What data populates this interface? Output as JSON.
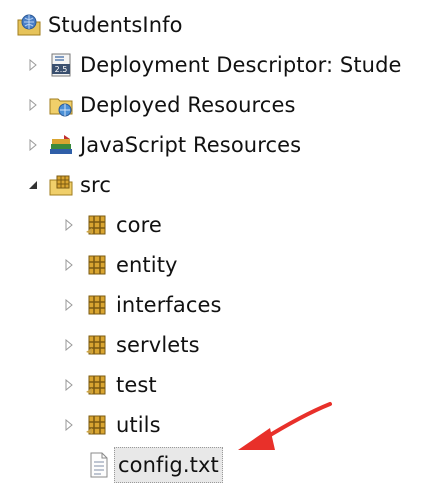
{
  "tree": {
    "project": {
      "label": "StudentsInfo",
      "icon": "web-project-icon"
    },
    "nodes": [
      {
        "id": "deployment-descriptor",
        "label": "Deployment Descriptor: Stude",
        "icon": "deployment-descriptor-icon",
        "expanded": false
      },
      {
        "id": "deployed-resources",
        "label": "Deployed Resources",
        "icon": "deployed-resources-icon",
        "expanded": false
      },
      {
        "id": "javascript-resources",
        "label": "JavaScript Resources",
        "icon": "javascript-resources-icon",
        "expanded": false
      },
      {
        "id": "src",
        "label": "src",
        "icon": "source-folder-icon",
        "expanded": true
      },
      {
        "id": "core",
        "label": "core",
        "icon": "package-icon",
        "expanded": false
      },
      {
        "id": "entity",
        "label": "entity",
        "icon": "package-icon",
        "expanded": false
      },
      {
        "id": "interfaces",
        "label": "interfaces",
        "icon": "package-icon",
        "expanded": false
      },
      {
        "id": "servlets",
        "label": "servlets",
        "icon": "package-icon",
        "expanded": false
      },
      {
        "id": "test",
        "label": "test",
        "icon": "package-icon",
        "expanded": false
      },
      {
        "id": "utils",
        "label": "utils",
        "icon": "package-icon",
        "expanded": false
      },
      {
        "id": "config-txt",
        "label": "config.txt",
        "icon": "text-file-icon",
        "selected": true
      }
    ]
  },
  "annotation": {
    "icon": "red-arrow-icon",
    "color": "#e8302a"
  },
  "colors": {
    "package": "#c8a040",
    "package-dark": "#8a6a1a",
    "selection": "#e8e8e8"
  }
}
